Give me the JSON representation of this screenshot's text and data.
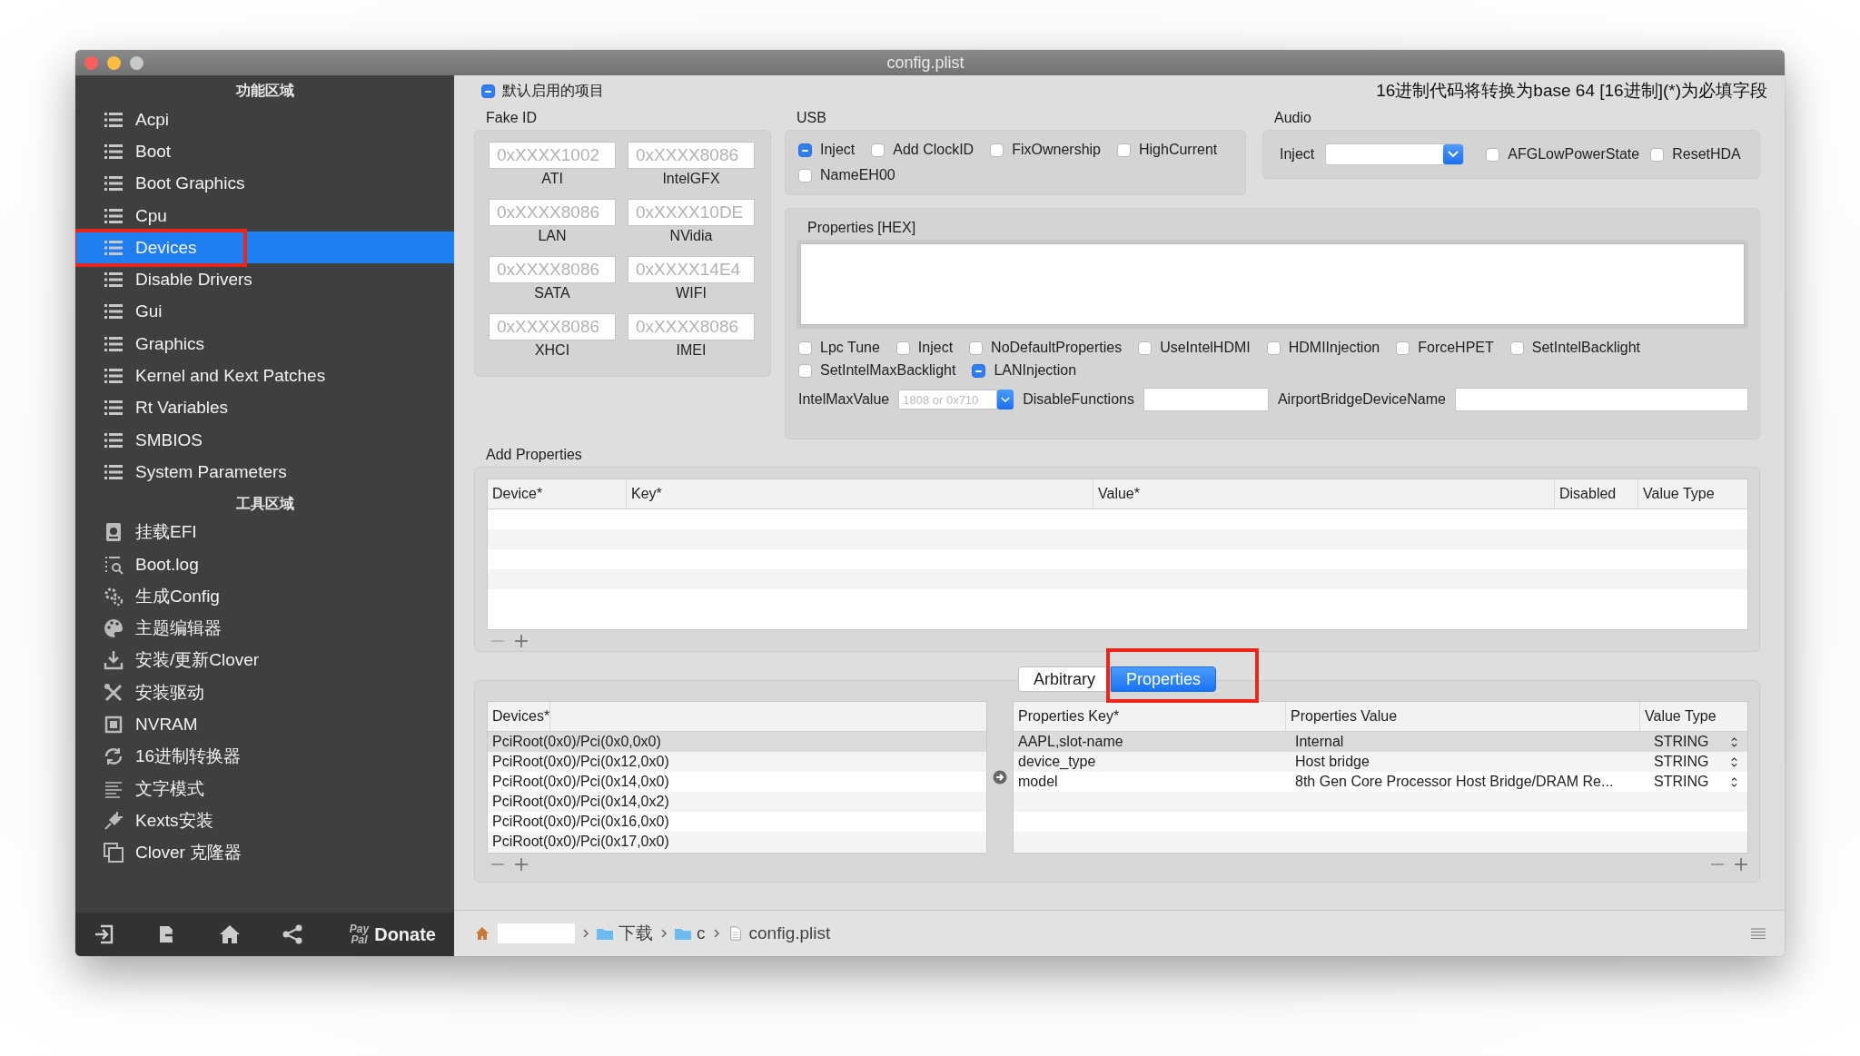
{
  "window": {
    "title": "config.plist"
  },
  "sidebar": {
    "sections": [
      {
        "heading": "功能区域",
        "items": [
          {
            "label": "Acpi",
            "selected": false
          },
          {
            "label": "Boot",
            "selected": false
          },
          {
            "label": "Boot Graphics",
            "selected": false
          },
          {
            "label": "Cpu",
            "selected": false
          },
          {
            "label": "Devices",
            "selected": true
          },
          {
            "label": "Disable Drivers",
            "selected": false
          },
          {
            "label": "Gui",
            "selected": false
          },
          {
            "label": "Graphics",
            "selected": false
          },
          {
            "label": "Kernel and Kext Patches",
            "selected": false
          },
          {
            "label": "Rt Variables",
            "selected": false
          },
          {
            "label": "SMBIOS",
            "selected": false
          },
          {
            "label": "System Parameters",
            "selected": false
          }
        ]
      },
      {
        "heading": "工具区域",
        "items": [
          {
            "label": "挂载EFI",
            "selected": false
          },
          {
            "label": "Boot.log",
            "selected": false
          },
          {
            "label": "生成Config",
            "selected": false
          },
          {
            "label": "主题编辑器",
            "selected": false
          },
          {
            "label": "安装/更新Clover",
            "selected": false
          },
          {
            "label": "安装驱动",
            "selected": false
          },
          {
            "label": "NVRAM",
            "selected": false
          },
          {
            "label": "16进制转换器",
            "selected": false
          },
          {
            "label": "文字模式",
            "selected": false
          },
          {
            "label": "Kexts安装",
            "selected": false
          },
          {
            "label": "Clover 克隆器",
            "selected": false
          }
        ]
      }
    ],
    "footer": {
      "paypal": [
        "Pay",
        "Pal"
      ],
      "donate": "Donate"
    }
  },
  "header": {
    "default_items": {
      "label": "默认启用的项目",
      "checked": true
    },
    "notice": "16进制代码将转换为base 64 [16进制](*)为必填字段"
  },
  "fake_id": {
    "title": "Fake ID",
    "fields": [
      {
        "placeholder": "0xXXXX1002",
        "label": "ATI"
      },
      {
        "placeholder": "0xXXXX8086",
        "label": "IntelGFX"
      },
      {
        "placeholder": "0xXXXX8086",
        "label": "LAN"
      },
      {
        "placeholder": "0xXXXX10DE",
        "label": "NVidia"
      },
      {
        "placeholder": "0xXXXX8086",
        "label": "SATA"
      },
      {
        "placeholder": "0xXXXX14E4",
        "label": "WIFI"
      },
      {
        "placeholder": "0xXXXX8086",
        "label": "XHCI"
      },
      {
        "placeholder": "0xXXXX8086",
        "label": "IMEI"
      }
    ]
  },
  "usb": {
    "title": "USB",
    "options": [
      {
        "label": "Inject",
        "checked": true
      },
      {
        "label": "Add ClockID",
        "checked": false
      },
      {
        "label": "FixOwnership",
        "checked": false
      },
      {
        "label": "HighCurrent",
        "checked": false
      },
      {
        "label": "NameEH00",
        "checked": false
      }
    ]
  },
  "audio": {
    "title": "Audio",
    "inject_label": "Inject",
    "options": [
      {
        "label": "AFGLowPowerState",
        "checked": false
      },
      {
        "label": "ResetHDA",
        "checked": false
      }
    ]
  },
  "properties_hex": {
    "title": "Properties [HEX]",
    "options": [
      {
        "label": "Lpc Tune",
        "checked": false
      },
      {
        "label": "Inject",
        "checked": false
      },
      {
        "label": "NoDefaultProperties",
        "checked": false
      },
      {
        "label": "UseIntelHDMI",
        "checked": false
      },
      {
        "label": "HDMIInjection",
        "checked": false
      },
      {
        "label": "ForceHPET",
        "checked": false
      },
      {
        "label": "SetIntelBacklight",
        "checked": false
      },
      {
        "label": "SetIntelMaxBacklight",
        "checked": false
      },
      {
        "label": "LANInjection",
        "checked": true
      }
    ],
    "intel_max_value": {
      "label": "IntelMaxValue",
      "placeholder": "1808 or 0x710"
    },
    "disable_functions": {
      "label": "DisableFunctions"
    },
    "airport_bridge": {
      "label": "AirportBridgeDeviceName"
    }
  },
  "add_properties": {
    "title": "Add Properties",
    "columns": [
      "Device*",
      "Key*",
      "Value*",
      "Disabled",
      "Value Type"
    ]
  },
  "tabs": [
    {
      "label": "Arbitrary",
      "selected": false
    },
    {
      "label": "Properties",
      "selected": true
    }
  ],
  "devices_table": {
    "columns": [
      "Devices*"
    ],
    "rows": [
      {
        "device": "PciRoot(0x0)/Pci(0x0,0x0)",
        "selected": true
      },
      {
        "device": "PciRoot(0x0)/Pci(0x12,0x0)",
        "selected": false
      },
      {
        "device": "PciRoot(0x0)/Pci(0x14,0x0)",
        "selected": false
      },
      {
        "device": "PciRoot(0x0)/Pci(0x14,0x2)",
        "selected": false
      },
      {
        "device": "PciRoot(0x0)/Pci(0x16,0x0)",
        "selected": false
      },
      {
        "device": "PciRoot(0x0)/Pci(0x17,0x0)",
        "selected": false
      }
    ]
  },
  "properties_table": {
    "columns": [
      "Properties Key*",
      "Properties Value",
      "Value Type"
    ],
    "rows": [
      {
        "key": "AAPL,slot-name",
        "value": "Internal",
        "type": "STRING",
        "selected": true
      },
      {
        "key": "device_type",
        "value": "Host bridge",
        "type": "STRING",
        "selected": false
      },
      {
        "key": "model",
        "value": "8th Gen Core Processor Host Bridge/DRAM Re...",
        "type": "STRING",
        "selected": false
      }
    ]
  },
  "path_bar": {
    "crumbs": [
      {
        "label": "下载",
        "kind": "folder"
      },
      {
        "label": "c",
        "kind": "folder"
      },
      {
        "label": "config.plist",
        "kind": "file"
      }
    ]
  }
}
